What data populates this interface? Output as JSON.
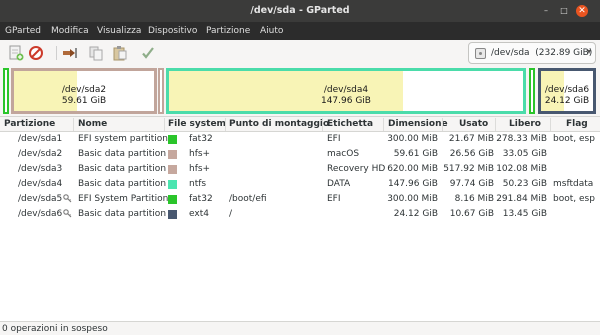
{
  "window": {
    "title": "/dev/sda - GParted",
    "minimize_glyph": "–",
    "maximize_glyph": "□",
    "close_glyph": "✕"
  },
  "menu": [
    "GParted",
    "Modifica",
    "Visualizza",
    "Dispositivo",
    "Partizione",
    "Aiuto"
  ],
  "toolbar": {
    "icons": [
      "new-partition-icon",
      "delete-icon",
      "resize-move-icon",
      "copy-icon",
      "paste-icon",
      "apply-icon"
    ]
  },
  "device_selector": {
    "device": "/dev/sda",
    "size": "(232.89 GiB)",
    "caret": "▾"
  },
  "disk_map": [
    {
      "name": "/dev/sda2",
      "size": "59.61 GiB",
      "border_color": "#c1a59b",
      "used_fraction": 0.45
    },
    {
      "name": "/dev/sda4",
      "size": "147.96 GiB",
      "border_color": "#4bdcaa",
      "used_fraction": 0.66
    },
    {
      "name": "/dev/sda6",
      "size": "24.12 GiB",
      "border_color": "#485870",
      "used_fraction": 0.44
    }
  ],
  "columns": {
    "partition": "Partizione",
    "name": "Nome",
    "filesystem": "File system",
    "mountpoint": "Punto di montaggio",
    "label": "Etichetta",
    "size": "Dimensione",
    "used": "Usato",
    "free": "Libero",
    "flags": "Flag"
  },
  "partitions": [
    {
      "partition": "/dev/sda1",
      "name": "EFI system partition",
      "fs_color": "#2ac52a",
      "filesystem": "fat32",
      "mountpoint": "",
      "label": "EFI",
      "size": "300.00 MiB",
      "used": "21.67 MiB",
      "free": "278.33 MiB",
      "flags": "boot, esp",
      "key": false
    },
    {
      "partition": "/dev/sda2",
      "name": "Basic data partition",
      "fs_color": "#c6a89e",
      "filesystem": "hfs+",
      "mountpoint": "",
      "label": "macOS",
      "size": "59.61 GiB",
      "used": "26.56 GiB",
      "free": "33.05 GiB",
      "flags": "",
      "key": false
    },
    {
      "partition": "/dev/sda3",
      "name": "Basic data partition",
      "fs_color": "#c6a89e",
      "filesystem": "hfs+",
      "mountpoint": "",
      "label": "Recovery HD",
      "size": "620.00 MiB",
      "used": "517.92 MiB",
      "free": "102.08 MiB",
      "flags": "",
      "key": false
    },
    {
      "partition": "/dev/sda4",
      "name": "Basic data partition",
      "fs_color": "#4be5b0",
      "filesystem": "ntfs",
      "mountpoint": "",
      "label": "DATA",
      "size": "147.96 GiB",
      "used": "97.74 GiB",
      "free": "50.23 GiB",
      "flags": "msftdata",
      "key": false
    },
    {
      "partition": "/dev/sda5",
      "name": "EFI System Partition",
      "fs_color": "#2ac52a",
      "filesystem": "fat32",
      "mountpoint": "/boot/efi",
      "label": "EFI",
      "size": "300.00 MiB",
      "used": "8.16 MiB",
      "free": "291.84 MiB",
      "flags": "boot, esp",
      "key": true
    },
    {
      "partition": "/dev/sda6",
      "name": "Basic data partition",
      "fs_color": "#485870",
      "filesystem": "ext4",
      "mountpoint": "/",
      "label": "",
      "size": "24.12 GiB",
      "used": "10.67 GiB",
      "free": "13.45 GiB",
      "flags": "",
      "key": true
    }
  ],
  "status": "0 operazioni in sospeso"
}
